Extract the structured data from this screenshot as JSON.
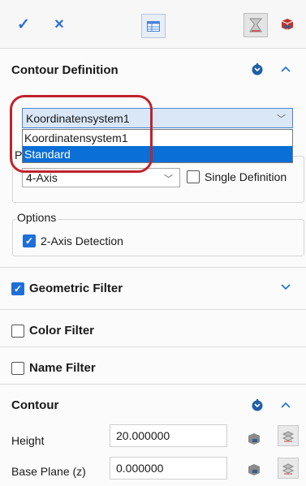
{
  "toolbar": {
    "confirm_glyph": "✓",
    "cancel_glyph": "×",
    "icons": [
      "check-icon",
      "close-icon",
      "table-icon",
      "filter-icon",
      "cube-icon"
    ]
  },
  "contour_definition": {
    "title": "Contour Definition",
    "coordinate_system": {
      "selected": "Koordinatensystem1",
      "options": [
        "Koordinatensystem1",
        "Standard"
      ],
      "highlighted_option": "Standard"
    },
    "group_label_fragment": "P",
    "axis_mode": {
      "value": "4-Axis"
    },
    "single_definition": {
      "label": "Single Definition",
      "checked": false
    },
    "options_group": {
      "label": "Options",
      "axis_detection": {
        "label": "2-Axis Detection",
        "checked": true
      }
    }
  },
  "geometric_filter": {
    "title": "Geometric Filter",
    "checked": true
  },
  "color_filter": {
    "title": "Color Filter",
    "checked": false
  },
  "name_filter": {
    "title": "Name Filter",
    "checked": false
  },
  "contour": {
    "title": "Contour",
    "height": {
      "label": "Height",
      "value": "20.000000"
    },
    "base_plane": {
      "label": "Base Plane (z)",
      "value": "0.000000"
    }
  },
  "colors": {
    "accent": "#1e6fd9",
    "selection": "#0a6fd6",
    "highlight_ring": "#c0222e",
    "combo_background": "#d9e7f7"
  }
}
